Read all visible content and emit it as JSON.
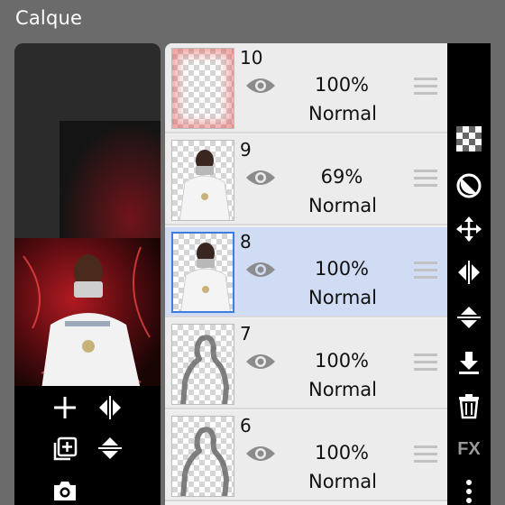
{
  "header": {
    "title": "Calque"
  },
  "layers": [
    {
      "number": "10",
      "opacity": "100%",
      "blend": "Normal",
      "selected": false
    },
    {
      "number": "9",
      "opacity": "69%",
      "blend": "Normal",
      "selected": false
    },
    {
      "number": "8",
      "opacity": "100%",
      "blend": "Normal",
      "selected": true
    },
    {
      "number": "7",
      "opacity": "100%",
      "blend": "Normal",
      "selected": false
    },
    {
      "number": "6",
      "opacity": "100%",
      "blend": "Normal",
      "selected": false
    }
  ],
  "rightbar": {
    "fx_label": "FX"
  },
  "colors": {
    "selected_row": "#cfdcf3",
    "selection_border": "#3d7de0",
    "background": "#6b6b6b"
  }
}
